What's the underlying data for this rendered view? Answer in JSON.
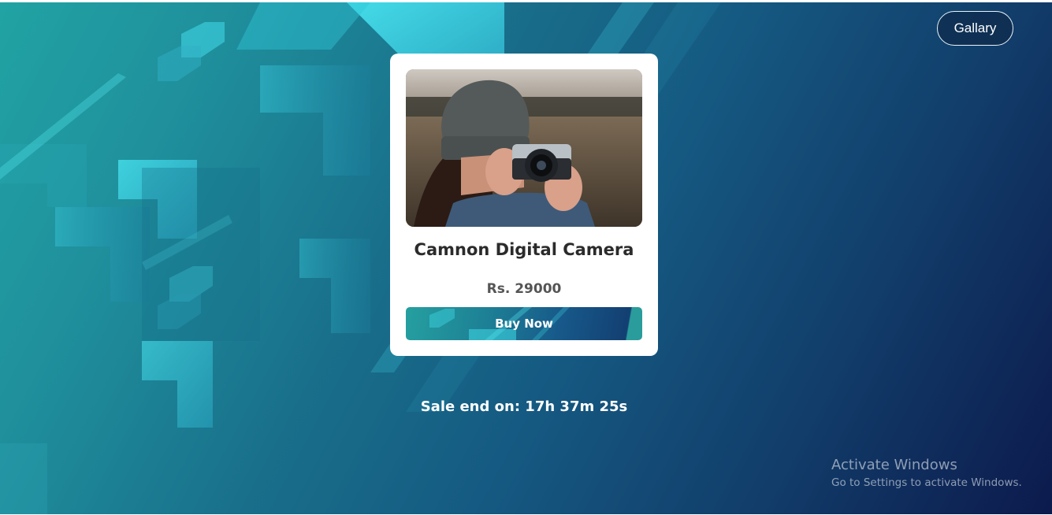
{
  "header": {
    "gallery_label": "Gallary"
  },
  "product": {
    "image_alt": "Person in a beanie holding a camera to their face",
    "name": "Camnon Digital Camera",
    "price": "Rs. 29000",
    "buy_label": "Buy Now"
  },
  "sale": {
    "text": "Sale end on: 17h 37m 25s"
  },
  "os_watermark": {
    "line1": "Activate Windows",
    "line2": "Go to Settings to activate Windows."
  },
  "colors": {
    "bg_start": "#21a3a3",
    "bg_end": "#0c1a4c",
    "arrow_accent": "#3fe0ee",
    "card_bg": "#ffffff"
  }
}
